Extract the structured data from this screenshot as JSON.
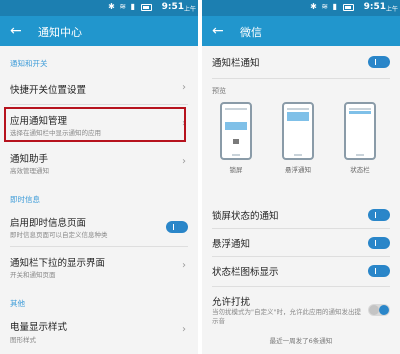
{
  "left": {
    "status": {
      "time": "9:51",
      "ampm": "上午",
      "icons": "✱ ≋ ▮"
    },
    "title": "通知中心",
    "sections": [
      {
        "label": "通知和开关"
      },
      {
        "label": "即时信息"
      },
      {
        "label": "其他"
      }
    ],
    "items": [
      {
        "title": "快捷开关位置设置",
        "subtitle": ""
      },
      {
        "title": "应用通知管理",
        "subtitle": "选择在通知栏中显示通知的应用"
      },
      {
        "title": "通知助手",
        "subtitle": "高效管理通知"
      },
      {
        "title": "启用即时信息页面",
        "subtitle": "即时信息页面可以自定义信息种类"
      },
      {
        "title": "通知栏下拉的显示界面",
        "subtitle": "开关和通知页面"
      },
      {
        "title": "电量显示样式",
        "subtitle": "图形样式"
      }
    ]
  },
  "right": {
    "status": {
      "time": "9:51",
      "ampm": "上午",
      "icons": "✱ ≋ ▮"
    },
    "title": "微信",
    "notify_bar": "通知栏通知",
    "preview_label": "预览",
    "previews": [
      "锁屏",
      "悬浮通知",
      "状态栏"
    ],
    "toggles": [
      {
        "label": "锁屏状态的通知",
        "on": true
      },
      {
        "label": "悬浮通知",
        "on": true
      },
      {
        "label": "状态栏图标显示",
        "on": true
      }
    ],
    "dnd": {
      "title": "允许打扰",
      "subtitle": "当勿扰模式为\"自定义\"时，允许此应用的通知发出提示音",
      "on": false
    },
    "footer": "最近一周发了6条通知"
  }
}
